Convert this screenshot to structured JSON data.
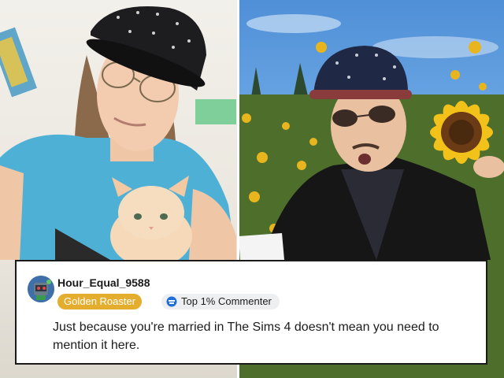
{
  "comment": {
    "username": "Hour_Equal_9588",
    "flair": "Golden Roaster",
    "badge": "Top 1% Commenter",
    "badge_icon": "commenter-badge-icon",
    "avatar_icon": "snoo-avatar-icon",
    "body": "Just because you're married in The Sims 4 doesn't mean you need to mention it here.",
    "colors": {
      "flair_bg": "#e5ad2e",
      "badge_bg": "#edeff1",
      "card_border": "#1a1a1a"
    }
  }
}
